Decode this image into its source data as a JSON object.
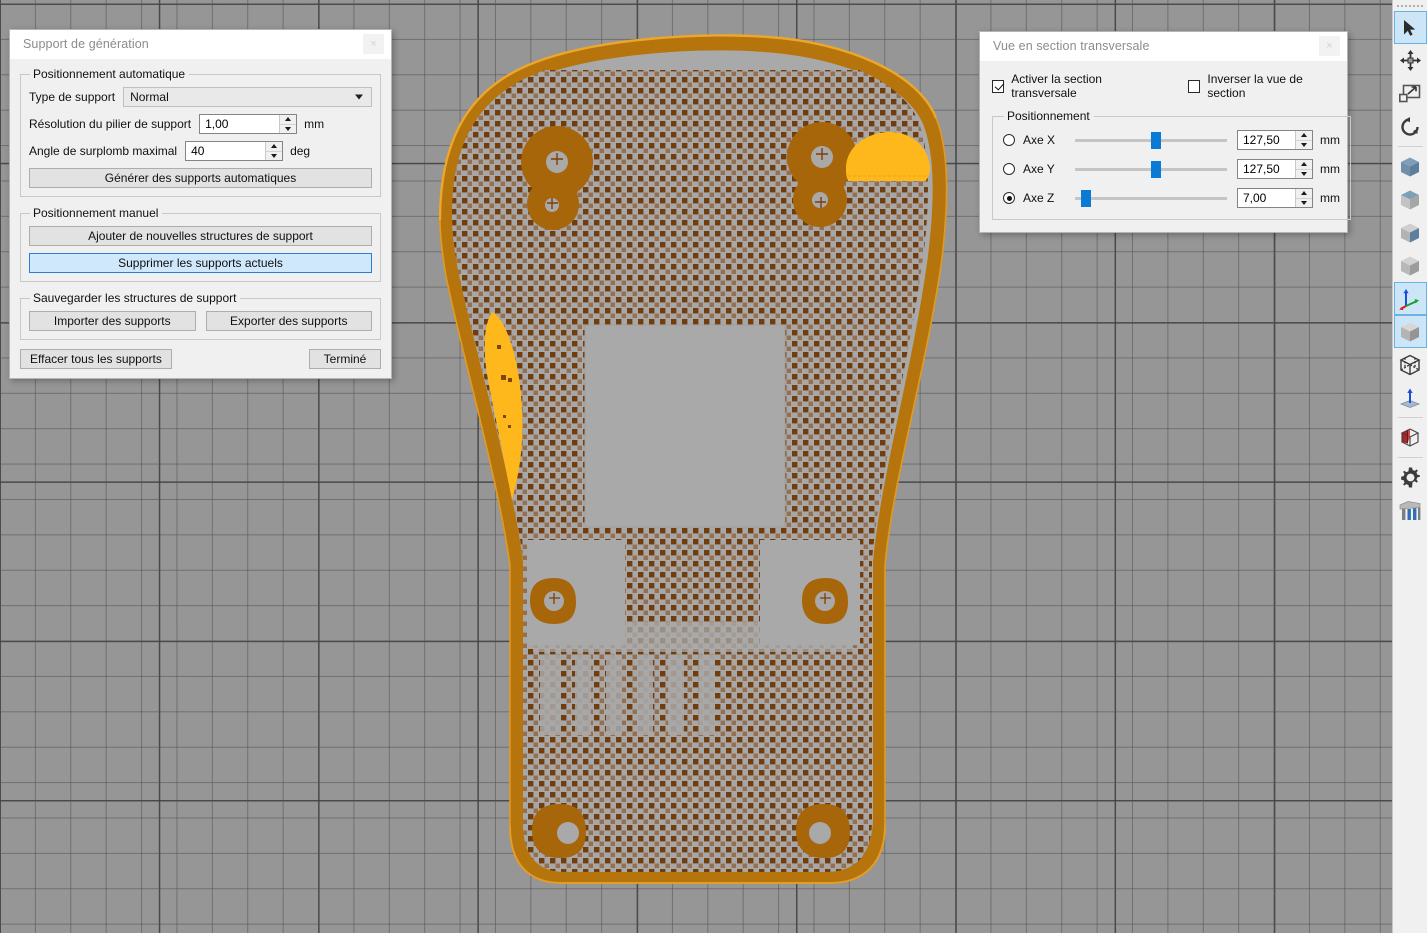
{
  "viewport": {
    "name": "3d-print-preview",
    "background_color": "#969696",
    "grid_line_color": "#505050",
    "model": {
      "body_color": "#b5740c",
      "body_color_light": "#c98a14",
      "overhang_color": "#ffb81c",
      "support_color": "#8c4a08",
      "section_fill": "#a8a8a8",
      "description": "Cross-sectioned 3D-printed handheld console shell with automatic support lattice"
    }
  },
  "support_dialog": {
    "title": "Support de génération",
    "close_label": "×",
    "auto_group": {
      "legend": "Positionnement automatique",
      "support_type_label": "Type de support",
      "support_type_value": "Normal",
      "support_type_options": [
        "Normal"
      ],
      "pillar_resolution_label": "Résolution du pilier de support",
      "pillar_resolution_value": "1,00",
      "pillar_resolution_unit": "mm",
      "overhang_angle_label": "Angle de surplomb maximal",
      "overhang_angle_value": "40",
      "overhang_angle_unit": "deg",
      "generate_button": "Générer des supports automatiques"
    },
    "manual_group": {
      "legend": "Positionnement manuel",
      "add_button": "Ajouter de nouvelles structures de support",
      "remove_button": "Supprimer les supports actuels"
    },
    "save_group": {
      "legend": "Sauvegarder les structures de support",
      "import_button": "Importer des supports",
      "export_button": "Exporter des supports"
    },
    "clear_button": "Effacer tous les supports",
    "done_button": "Terminé"
  },
  "cross_section_dialog": {
    "title": "Vue en section transversale",
    "close_label": "×",
    "enable_checkbox_label": "Activer la section transversale",
    "enable_checked": true,
    "invert_checkbox_label": "Inverser la vue de section",
    "invert_checked": false,
    "positioning_group": {
      "legend": "Positionnement",
      "axes": [
        {
          "label": "Axe X",
          "selected": false,
          "value": "127,50",
          "unit": "mm",
          "slider_percent": 53
        },
        {
          "label": "Axe Y",
          "selected": false,
          "value": "127,50",
          "unit": "mm",
          "slider_percent": 53
        },
        {
          "label": "Axe Z",
          "selected": true,
          "value": "7,00",
          "unit": "mm",
          "slider_percent": 4
        }
      ]
    }
  },
  "toolbar": {
    "name": "view-tools",
    "accent_color": "#cde6f7",
    "items": [
      {
        "icon": "cursor-arrow-icon",
        "tooltip": "Sélectionner",
        "active": true
      },
      {
        "icon": "move-arrows-icon",
        "tooltip": "Déplacer",
        "active": false
      },
      {
        "icon": "scale-resize-icon",
        "tooltip": "Redimensionner",
        "active": false
      },
      {
        "icon": "rotate-icon",
        "tooltip": "Rotation",
        "active": false
      },
      {
        "separator": true
      },
      {
        "icon": "cube-front-view-icon",
        "tooltip": "Vue de face",
        "active": false
      },
      {
        "icon": "cube-left-view-icon",
        "tooltip": "Vue de gauche",
        "active": false
      },
      {
        "icon": "cube-right-view-icon",
        "tooltip": "Vue de droite",
        "active": false
      },
      {
        "icon": "cube-top-view-icon",
        "tooltip": "Vue de dessus",
        "active": false
      },
      {
        "icon": "axis-gizmo-icon",
        "tooltip": "Repère d'axes",
        "active": true
      },
      {
        "icon": "solid-cube-icon",
        "tooltip": "Affichage solide",
        "active": true
      },
      {
        "icon": "wireframe-cube-icon",
        "tooltip": "Fil de fer",
        "active": false
      },
      {
        "icon": "normal-vector-icon",
        "tooltip": "Normales",
        "active": false
      },
      {
        "separator": true
      },
      {
        "icon": "cross-section-cube-icon",
        "tooltip": "Section transversale",
        "active": false
      },
      {
        "separator": true
      },
      {
        "icon": "gear-icon",
        "tooltip": "Paramètres",
        "active": false
      },
      {
        "icon": "supports-icon",
        "tooltip": "Supports",
        "active": false
      }
    ]
  }
}
